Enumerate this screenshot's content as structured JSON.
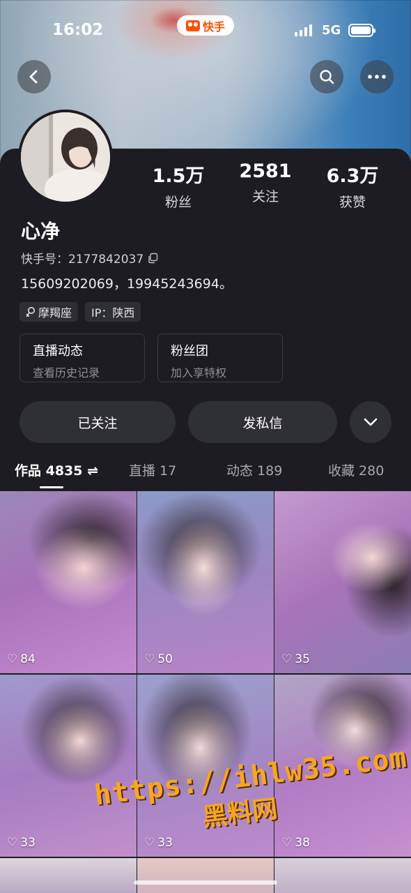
{
  "status_bar": {
    "time": "16:02",
    "app_badge": "快手",
    "network": "5G"
  },
  "header_buttons": {
    "back_icon": "chevron-left-icon",
    "search_icon": "search-icon",
    "more_icon": "ellipsis-icon"
  },
  "profile": {
    "nickname": "心净",
    "kuaishou_id_label": "快手号：2177842037",
    "bio": "15609202069，19945243694。",
    "tags": [
      {
        "icon": "gender-female-icon",
        "label": "摩羯座"
      },
      {
        "label": "IP：陕西"
      }
    ],
    "stats": [
      {
        "value": "1.5万",
        "label": "粉丝"
      },
      {
        "value": "2581",
        "label": "关注"
      },
      {
        "value": "6.3万",
        "label": "获赞"
      }
    ]
  },
  "feature_boxes": [
    {
      "title": "直播动态",
      "subtitle": "查看历史记录"
    },
    {
      "title": "粉丝团",
      "subtitle": "加入享特权"
    }
  ],
  "actions": {
    "follow_label": "已关注",
    "message_label": "发私信",
    "expand_icon": "chevron-down-icon"
  },
  "tabs": [
    {
      "label": "作品 4835 ⇌",
      "active": true
    },
    {
      "label": "直播 17",
      "active": false
    },
    {
      "label": "动态 189",
      "active": false
    },
    {
      "label": "收藏 280",
      "active": false
    }
  ],
  "grid": [
    {
      "likes": "84"
    },
    {
      "likes": "50"
    },
    {
      "likes": "35"
    },
    {
      "likes": "33"
    },
    {
      "likes": "33"
    },
    {
      "likes": "38"
    }
  ],
  "watermark": {
    "url": "https://ihlw35.com",
    "name": "黑料网"
  },
  "colors": {
    "card_bg": "#1c1c22",
    "button_bg": "#2f2f36",
    "accent": "#ff5000",
    "watermark": "#f5a623"
  }
}
